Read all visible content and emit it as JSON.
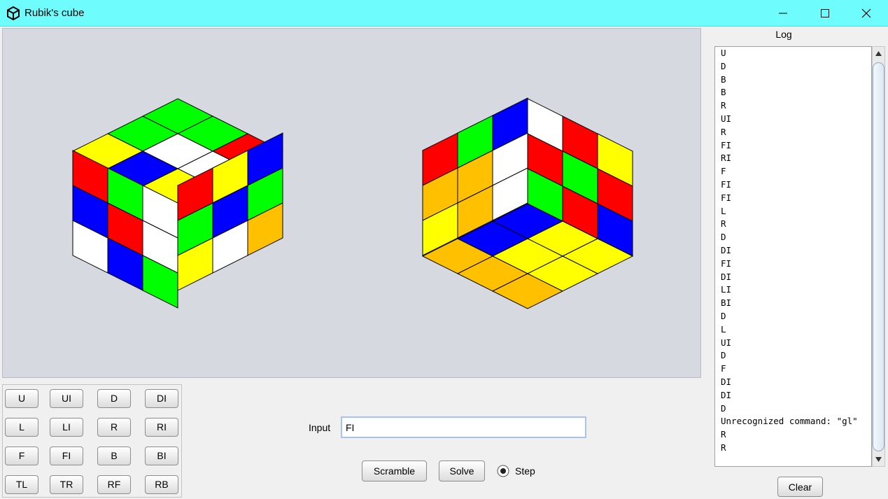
{
  "window": {
    "title": "Rubik's cube",
    "controls": {
      "minimize": "minimize-icon",
      "maximize": "maximize-icon",
      "close": "close-icon"
    },
    "titlebar_color": "#6ffcfc"
  },
  "cube_view": {
    "colors": {
      "red": "#ff0000",
      "green": "#00ff00",
      "blue": "#0000ff",
      "white": "#ffffff",
      "yellow": "#ffff00",
      "orange": "#ffc000"
    },
    "front_view": {
      "top": [
        [
          "green",
          "green",
          "red"
        ],
        [
          "green",
          "white",
          "white"
        ],
        [
          "yellow",
          "blue",
          "yellow"
        ]
      ],
      "left": [
        [
          "red",
          "green",
          "white"
        ],
        [
          "blue",
          "red",
          "white"
        ],
        [
          "white",
          "blue",
          "green"
        ]
      ],
      "right": [
        [
          "red",
          "yellow",
          "blue"
        ],
        [
          "green",
          "blue",
          "green"
        ],
        [
          "yellow",
          "white",
          "orange"
        ]
      ]
    },
    "back_view": {
      "left": [
        [
          "red",
          "green",
          "blue"
        ],
        [
          "orange",
          "orange",
          "white"
        ],
        [
          "yellow",
          "orange",
          "white"
        ]
      ],
      "right": [
        [
          "white",
          "red",
          "yellow"
        ],
        [
          "red",
          "green",
          "red"
        ],
        [
          "green",
          "red",
          "blue"
        ]
      ],
      "bottom": [
        [
          "blue",
          "yellow",
          "yellow"
        ],
        [
          "blue",
          "yellow",
          "yellow"
        ],
        [
          "orange",
          "orange",
          "orange"
        ]
      ]
    }
  },
  "moves": {
    "rows": [
      [
        "U",
        "UI",
        "D",
        "DI"
      ],
      [
        "L",
        "LI",
        "R",
        "RI"
      ],
      [
        "F",
        "FI",
        "B",
        "BI"
      ],
      [
        "TL",
        "TR",
        "RF",
        "RB"
      ]
    ]
  },
  "controls": {
    "input_label": "Input",
    "input_value": "FI",
    "scramble_label": "Scramble",
    "solve_label": "Solve",
    "step_label": "Step",
    "step_selected": true
  },
  "log": {
    "title": "Log",
    "lines": [
      "U",
      "D",
      "B",
      "B",
      "R",
      "UI",
      "R",
      "FI",
      "RI",
      "F",
      "FI",
      "FI",
      "L",
      "R",
      "D",
      "DI",
      "FI",
      "DI",
      "LI",
      "BI",
      "D",
      "L",
      "UI",
      "D",
      "F",
      "DI",
      "DI",
      "D",
      "Unrecognized command: \"gl\"",
      "R",
      "R"
    ],
    "clear_label": "Clear"
  }
}
